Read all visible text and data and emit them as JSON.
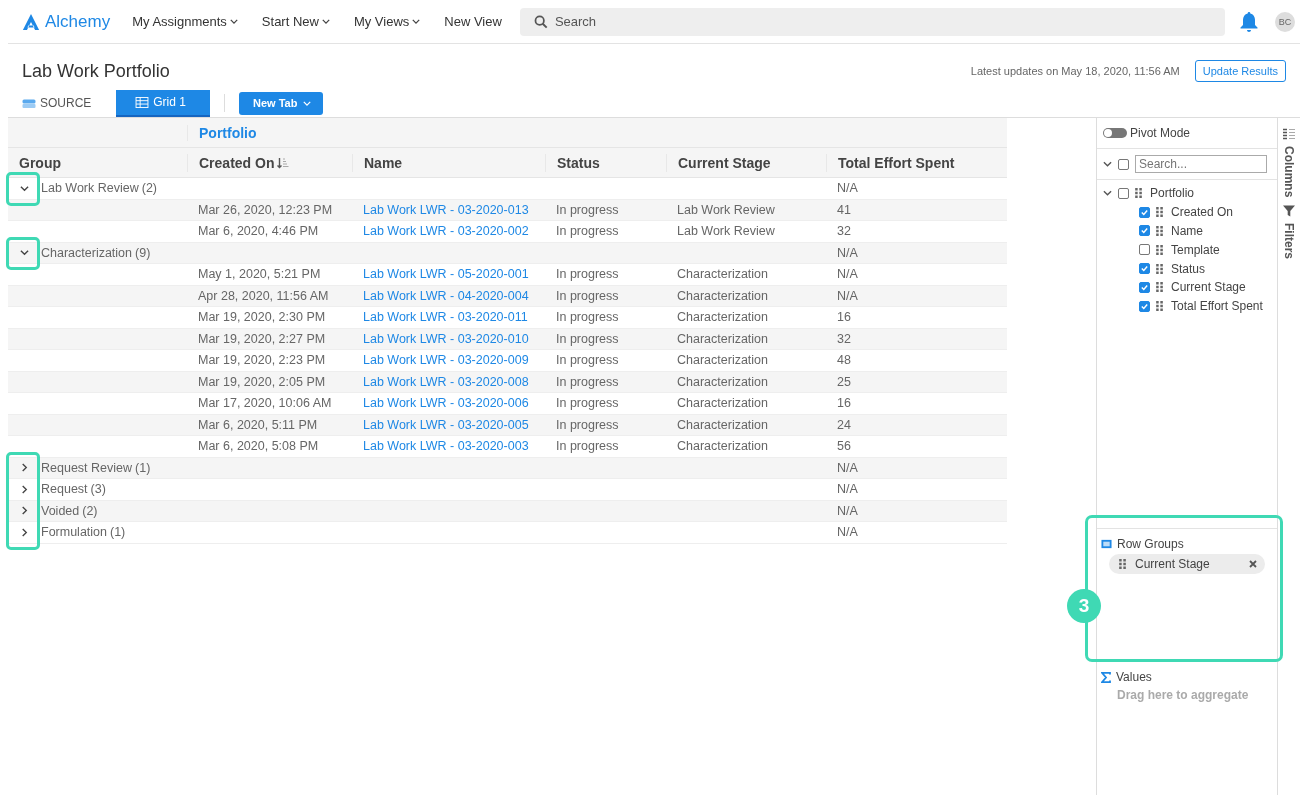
{
  "nav": {
    "logo": "Alchemy",
    "menu": [
      {
        "label": "My Assignments",
        "dropdown": true
      },
      {
        "label": "Start New",
        "dropdown": true
      },
      {
        "label": "My Views",
        "dropdown": true
      },
      {
        "label": "New View",
        "dropdown": false
      }
    ],
    "search": {
      "placeholder": "Search"
    },
    "avatar": "BC"
  },
  "page": {
    "title": "Lab Work Portfolio",
    "updated": "Latest updates on May 18, 2020, 11:56 AM",
    "update_button": "Update Results"
  },
  "tabs": [
    {
      "label": "SOURCE",
      "kind": "source",
      "selected": false
    },
    {
      "label": "Grid 1",
      "kind": "grid",
      "selected": true
    }
  ],
  "new_tab": "New Tab",
  "grid": {
    "column_group": "Portfolio",
    "columns": [
      {
        "label": "Group"
      },
      {
        "label": "Created On",
        "sort_descending": true
      },
      {
        "label": "Name"
      },
      {
        "label": "Status"
      },
      {
        "label": "Current Stage"
      },
      {
        "label": "Total Effort Spent"
      }
    ],
    "groups": [
      {
        "label": "Lab Work Review",
        "count": "(2)",
        "total": "N/A",
        "expanded": true,
        "highlighted": true,
        "rows": [
          [
            "Mar 26, 2020, 12:23 PM",
            "Lab Work LWR - 03-2020-013",
            "In progress",
            "Lab Work Review",
            "41"
          ],
          [
            "Mar 6, 2020, 4:46 PM",
            "Lab Work LWR - 03-2020-002",
            "In progress",
            "Lab Work Review",
            "32"
          ]
        ]
      },
      {
        "label": "Characterization",
        "count": "(9)",
        "total": "N/A",
        "expanded": true,
        "highlighted": true,
        "rows": [
          [
            "May 1, 2020, 5:21 PM",
            "Lab Work LWR - 05-2020-001",
            "In progress",
            "Characterization",
            "N/A"
          ],
          [
            "Apr 28, 2020, 11:56 AM",
            "Lab Work LWR - 04-2020-004",
            "In progress",
            "Characterization",
            "N/A"
          ],
          [
            "Mar 19, 2020, 2:30 PM",
            "Lab Work LWR - 03-2020-011",
            "In progress",
            "Characterization",
            "16"
          ],
          [
            "Mar 19, 2020, 2:27 PM",
            "Lab Work LWR - 03-2020-010",
            "In progress",
            "Characterization",
            "32"
          ],
          [
            "Mar 19, 2020, 2:23 PM",
            "Lab Work LWR - 03-2020-009",
            "In progress",
            "Characterization",
            "48"
          ],
          [
            "Mar 19, 2020, 2:05 PM",
            "Lab Work LWR - 03-2020-008",
            "In progress",
            "Characterization",
            "25"
          ],
          [
            "Mar 17, 2020, 10:06 AM",
            "Lab Work LWR - 03-2020-006",
            "In progress",
            "Characterization",
            "16"
          ],
          [
            "Mar 6, 2020, 5:11 PM",
            "Lab Work LWR - 03-2020-005",
            "In progress",
            "Characterization",
            "24"
          ],
          [
            "Mar 6, 2020, 5:08 PM",
            "Lab Work LWR - 03-2020-003",
            "In progress",
            "Characterization",
            "56"
          ]
        ]
      },
      {
        "label": "Request Review",
        "count": "(1)",
        "total": "N/A",
        "expanded": false,
        "highlighted": true
      },
      {
        "label": "Request",
        "count": "(3)",
        "total": "N/A",
        "expanded": false,
        "highlighted": true
      },
      {
        "label": "Voided",
        "count": "(2)",
        "total": "N/A",
        "expanded": false,
        "highlighted": true
      },
      {
        "label": "Formulation",
        "count": "(1)",
        "total": "N/A",
        "expanded": false,
        "highlighted": true
      }
    ]
  },
  "side_panel": {
    "pivot_mode": {
      "label": "Pivot Mode",
      "on": false
    },
    "column_search": {
      "placeholder": "Search..."
    },
    "select_all_checked": false,
    "tree": {
      "label": "Portfolio",
      "expanded": true,
      "checked": false,
      "children": [
        {
          "label": "Created On",
          "checked": true
        },
        {
          "label": "Name",
          "checked": true
        },
        {
          "label": "Template",
          "checked": false
        },
        {
          "label": "Status",
          "checked": true
        },
        {
          "label": "Current Stage",
          "checked": true
        },
        {
          "label": "Total Effort Spent",
          "checked": true
        }
      ]
    },
    "row_groups": {
      "title": "Row Groups",
      "chips": [
        "Current Stage"
      ],
      "highlighted": true,
      "callout": "3"
    },
    "values": {
      "title": "Values",
      "hint": "Drag here to aggregate"
    },
    "side_tabs": [
      {
        "label": "Columns",
        "kind": "columns"
      },
      {
        "label": "Filters",
        "kind": "filters"
      }
    ]
  }
}
